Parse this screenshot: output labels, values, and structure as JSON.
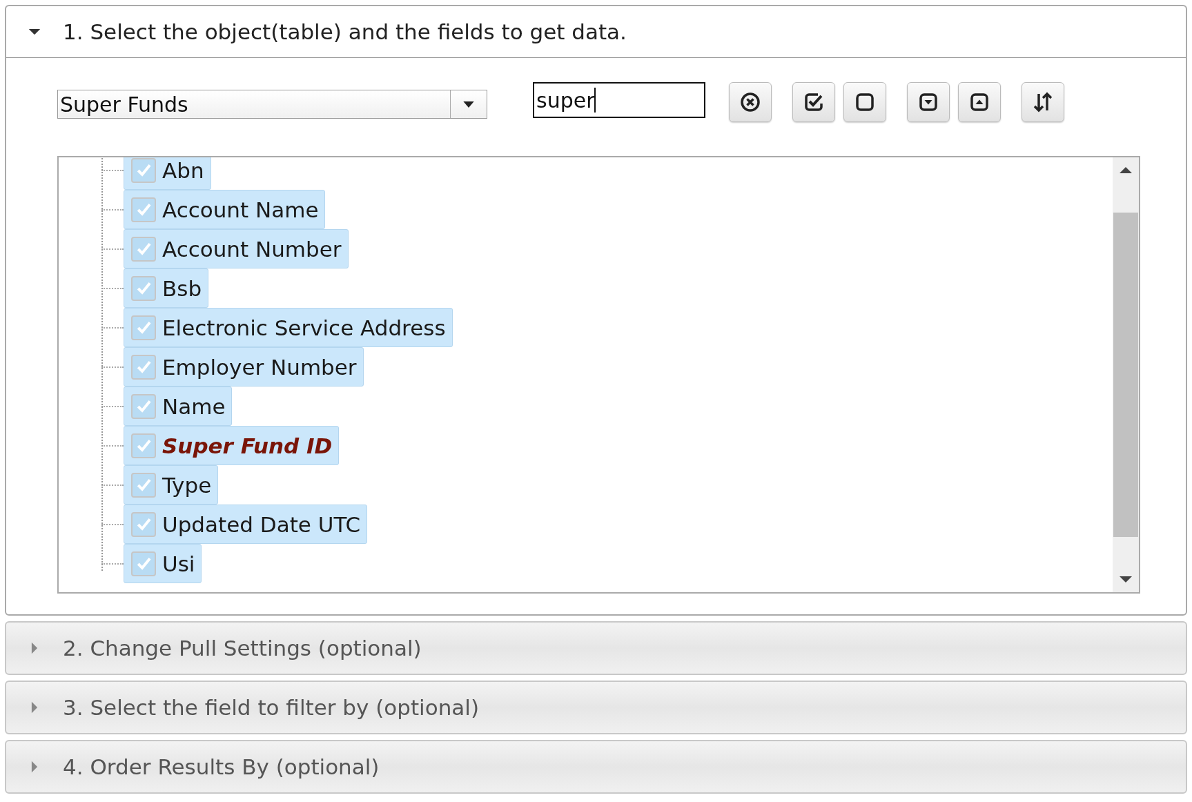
{
  "sections": [
    {
      "title": "1. Select the object(table) and the fields to get data.",
      "expanded": true
    },
    {
      "title": "2. Change Pull Settings (optional)",
      "expanded": false
    },
    {
      "title": "3. Select the field to filter by (optional)",
      "expanded": false
    },
    {
      "title": "4. Order Results By (optional)",
      "expanded": false
    }
  ],
  "object_select": {
    "value": "Super Funds"
  },
  "search": {
    "value": "super"
  },
  "toolbar": [
    {
      "kind": "clear"
    },
    {
      "kind": "check_all"
    },
    {
      "kind": "uncheck_all"
    },
    {
      "kind": "expand_all"
    },
    {
      "kind": "collapse_all"
    },
    {
      "kind": "sort"
    }
  ],
  "fields": [
    {
      "label": "Abn",
      "checked": true,
      "kind": "field"
    },
    {
      "label": "Account Name",
      "checked": true,
      "kind": "field"
    },
    {
      "label": "Account Number",
      "checked": true,
      "kind": "field"
    },
    {
      "label": "Bsb",
      "checked": true,
      "kind": "field"
    },
    {
      "label": "Electronic Service Address",
      "checked": true,
      "kind": "field"
    },
    {
      "label": "Employer Number",
      "checked": true,
      "kind": "field"
    },
    {
      "label": "Name",
      "checked": true,
      "kind": "field"
    },
    {
      "label": "Super Fund ID",
      "checked": true,
      "kind": "key"
    },
    {
      "label": "Type",
      "checked": true,
      "kind": "field"
    },
    {
      "label": "Updated Date UTC",
      "checked": true,
      "kind": "field"
    },
    {
      "label": "Usi",
      "checked": true,
      "kind": "field"
    }
  ]
}
